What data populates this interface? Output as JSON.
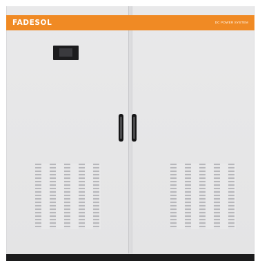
{
  "product": {
    "brand": "FADESOL",
    "subtitle": "DC POWER SYSTEM",
    "accent_color": "#f08a24",
    "body_color": "#e7e7e8",
    "base_color": "#1b1b1c"
  },
  "doors": {
    "count": 2
  },
  "icons": {
    "display": "display-panel",
    "handles": "door-handle",
    "vents": "vent-grille"
  }
}
